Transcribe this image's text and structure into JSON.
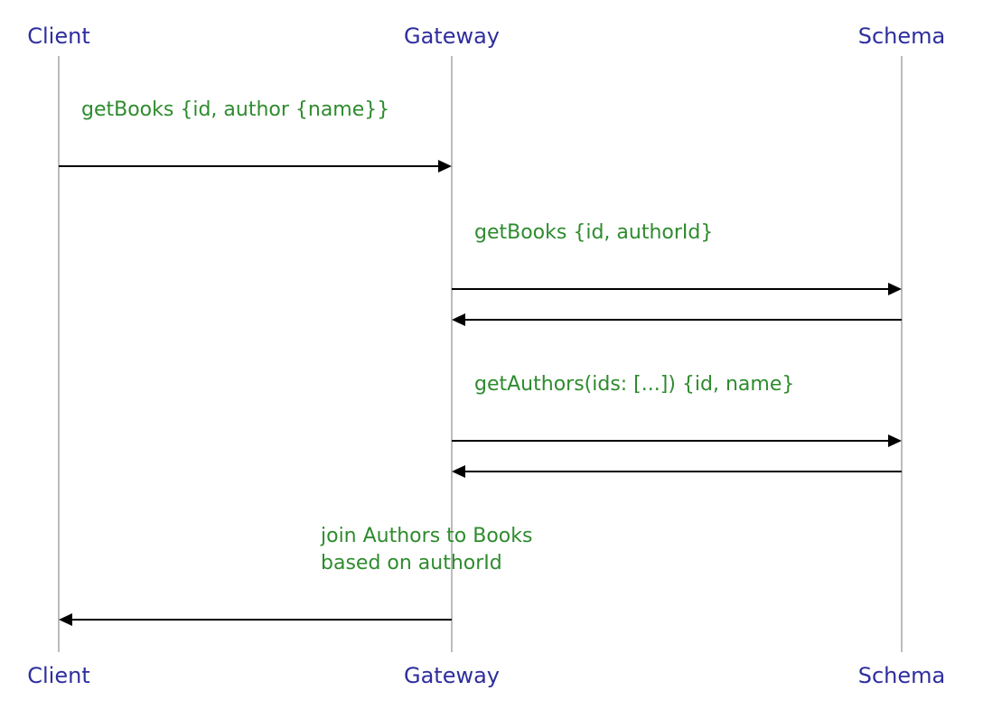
{
  "diagram": {
    "type": "sequence",
    "participants": {
      "client": {
        "label": "Client"
      },
      "gateway": {
        "label": "Gateway"
      },
      "schema": {
        "label": "Schema"
      }
    },
    "messages": {
      "m1": {
        "from": "client",
        "to": "gateway",
        "text": "getBooks {id, author {name}}"
      },
      "m2": {
        "from": "gateway",
        "to": "schema",
        "text": "getBooks {id, authorId}"
      },
      "m3": {
        "from": "schema",
        "to": "gateway",
        "text": ""
      },
      "m4": {
        "from": "gateway",
        "to": "schema",
        "text": "getAuthors(ids: [...]) {id, name}"
      },
      "m5": {
        "from": "schema",
        "to": "gateway",
        "text": ""
      },
      "m6": {
        "from": "gateway",
        "to": "client",
        "text_line1": "join Authors to Books",
        "text_line2": "based on authorId"
      }
    },
    "colors": {
      "participant": "#2e2e9e",
      "message": "#2e8b2e",
      "lifeline": "#bcbcbc",
      "arrow": "#000000",
      "background": "#ffffff"
    }
  }
}
